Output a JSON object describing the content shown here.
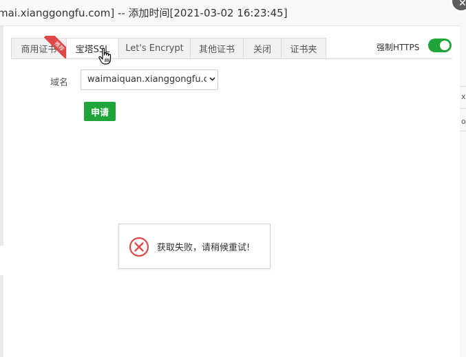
{
  "window": {
    "title": "mai.xianggongfu.com] -- 添加时间[2021-03-02 16:23:45]"
  },
  "tabs": [
    {
      "label": "商用证书",
      "badge": "推荐"
    },
    {
      "label": "宝塔SSL",
      "active": true
    },
    {
      "label": "Let's Encrypt"
    },
    {
      "label": "其他证书"
    },
    {
      "label": "关闭"
    },
    {
      "label": "证书夹"
    }
  ],
  "https": {
    "label": "强制HTTPS",
    "enabled": true
  },
  "form": {
    "domain_label": "域名",
    "domain_value": "waimaiquan.xianggongfu.com",
    "apply_label": "申请"
  },
  "toast": {
    "message": "获取失败，请稍候重试!",
    "icon": "error-icon"
  },
  "background_page": {
    "fragments": [
      "x",
      "o"
    ]
  },
  "colors": {
    "accent": "#20a53a",
    "badge": "#e04848",
    "error": "#e04848"
  }
}
